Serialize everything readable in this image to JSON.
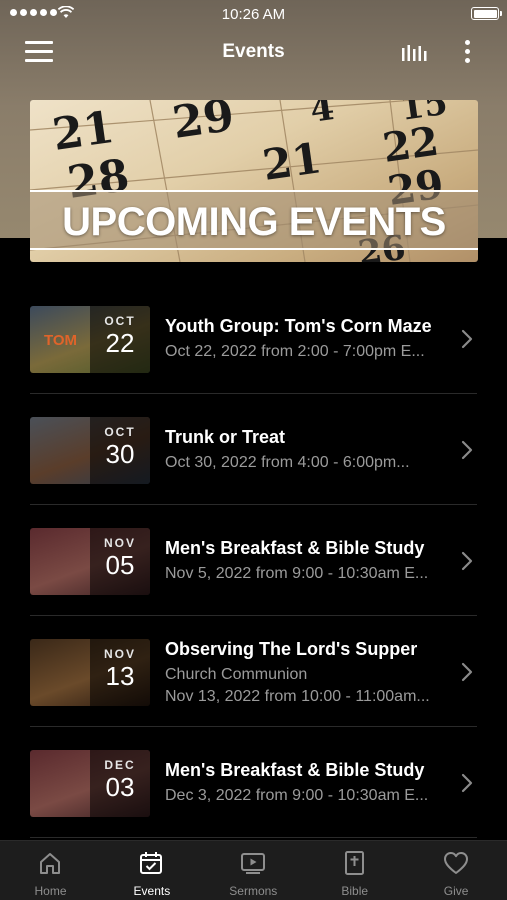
{
  "status_bar": {
    "time": "10:26 AM"
  },
  "header": {
    "title": "Events"
  },
  "banner": {
    "text": "UPCOMING EVENTS",
    "calendar_numbers": [
      "21",
      "29",
      "4",
      "15",
      "28",
      "21",
      "22",
      "29",
      "26"
    ]
  },
  "events": [
    {
      "month": "OCT",
      "day": "22",
      "title": "Youth Group: Tom's Corn Maze",
      "lines": [
        "Oct 22, 2022 from 2:00 - 7:00pm E..."
      ],
      "thumb_colors": [
        "#3c4a5c",
        "#7a6a3a",
        "#4d5a2a"
      ],
      "thumb_text": "TOM"
    },
    {
      "month": "OCT",
      "day": "30",
      "title": "Trunk or Treat",
      "lines": [
        "Oct 30, 2022 from 4:00 - 6:00pm..."
      ],
      "thumb_colors": [
        "#4a5058",
        "#5a3d2a",
        "#2e3a4a"
      ],
      "thumb_text": ""
    },
    {
      "month": "NOV",
      "day": "05",
      "title": "Men's Breakfast & Bible Study",
      "lines": [
        "Nov 5, 2022 from 9:00 - 10:30am E..."
      ],
      "thumb_colors": [
        "#5a2a2e",
        "#7a4a44",
        "#3a2022"
      ],
      "thumb_text": ""
    },
    {
      "month": "NOV",
      "day": "13",
      "title": "Observing The Lord's Supper",
      "lines": [
        "Church Communion",
        "Nov 13, 2022 from 10:00 - 11:00am..."
      ],
      "thumb_colors": [
        "#3a2818",
        "#6a4a2a",
        "#2a1a10"
      ],
      "thumb_text": ""
    },
    {
      "month": "DEC",
      "day": "03",
      "title": "Men's Breakfast & Bible Study",
      "lines": [
        "Dec 3, 2022 from 9:00 - 10:30am E..."
      ],
      "thumb_colors": [
        "#5a2a2e",
        "#7a4a44",
        "#3a2022"
      ],
      "thumb_text": ""
    }
  ],
  "tabs": [
    {
      "label": "Home",
      "icon": "home-icon",
      "active": false
    },
    {
      "label": "Events",
      "icon": "calendar-icon",
      "active": true
    },
    {
      "label": "Sermons",
      "icon": "video-icon",
      "active": false
    },
    {
      "label": "Bible",
      "icon": "bible-icon",
      "active": false
    },
    {
      "label": "Give",
      "icon": "heart-icon",
      "active": false
    }
  ],
  "colors": {
    "background": "#000000",
    "tab_bar": "#1d1d1d",
    "inactive": "#8e8e8e",
    "subtitle": "#9b9b9b"
  }
}
